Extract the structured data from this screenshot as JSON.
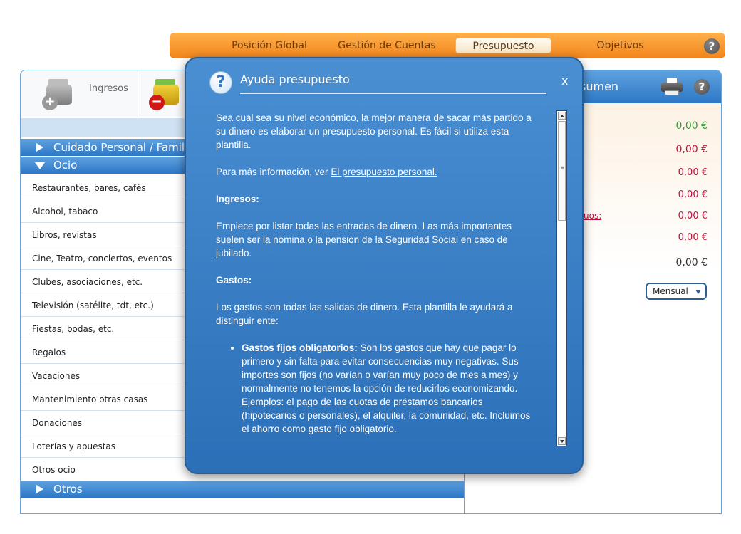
{
  "topnav": {
    "tabs": [
      {
        "label": "Posición Global",
        "active": false
      },
      {
        "label": "Gestión de Cuentas",
        "active": false
      },
      {
        "label": "Presupuesto",
        "active": true
      },
      {
        "label": "Objetivos",
        "active": false
      }
    ],
    "help_icon": "question-icon"
  },
  "left_panel": {
    "top_buttons": [
      {
        "label": "Ingresos",
        "icon": "income-wallet-plus-icon"
      },
      {
        "label": "",
        "icon": "expense-wallet-minus-icon"
      }
    ],
    "categories": [
      {
        "label": "Cuidado Personal / Familiar",
        "expanded": false
      },
      {
        "label": "Ocio",
        "expanded": true
      },
      {
        "label": "Otros",
        "expanded": false
      }
    ],
    "ocio_items": [
      "Restaurantes, bares, cafés",
      "Alcohol, tabaco",
      "Libros, revistas",
      "Cine, Teatro, conciertos, eventos",
      "Clubes, asociaciones, etc.",
      "Televisión (satélite, tdt, etc.)",
      "Fiestas, bodas, etc.",
      "Regalos",
      "Vacaciones",
      "Mantenimiento otras casas",
      "Donaciones",
      "Loterías y apuestas",
      "Otros ocio"
    ]
  },
  "right_panel": {
    "title_fragment": "sumen",
    "link_fragment": "uos:",
    "amounts": [
      {
        "value": "0,00 €",
        "color": "#3a9a3a"
      },
      {
        "value": "0,00 €",
        "color": "#c0103a"
      },
      {
        "value": "0,00 €",
        "color": "#c0103a"
      },
      {
        "value": "0,00 €",
        "color": "#c0103a"
      },
      {
        "value": "0,00 €",
        "color": "#c0103a"
      },
      {
        "value": "0,00 €",
        "color": "#c0103a"
      },
      {
        "value": "0,00 €",
        "color": "#333333"
      }
    ],
    "period_select": "Mensual"
  },
  "modal": {
    "title": "Ayuda presupuesto",
    "close_label": "x",
    "intro": "Sea cual sea su nivel económico, la mejor manera de sacar más partido a su dinero es elaborar un presupuesto personal. Es fácil si utiliza esta plantilla.",
    "more_info_prefix": "Para más información, ver ",
    "more_info_link": "El presupuesto personal.",
    "ingresos_heading": "Ingresos:",
    "ingresos_text": "Empiece por listar todas las entradas de dinero. Las más importantes suelen ser la nómina o la pensión de la Seguridad Social en caso de jubilado.",
    "gastos_heading": "Gastos:",
    "gastos_text": "Los gastos son todas las salidas de dinero. Esta plantilla le ayudará a distinguir ente:",
    "bullet_heading": "Gastos fijos obligatorios:",
    "bullet_text": " Son los gastos que hay que pagar lo primero y sin falta para evitar consecuencias muy negativas. Sus importes son fijos (no varían o varían muy poco de mes a mes) y normalmente no tenemos la opción de reducirlos economizando. Ejemplos: el pago de las cuotas de préstamos bancarios (hipotecarios o personales), el alquiler, la comunidad, etc. Incluimos el ahorro como gasto fijo obligatorio."
  }
}
